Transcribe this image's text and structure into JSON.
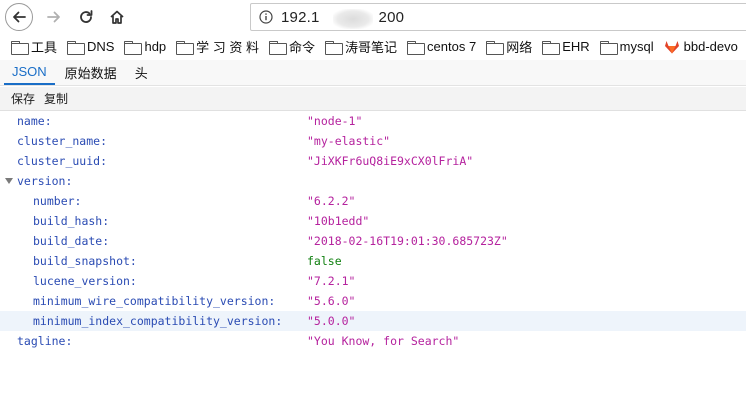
{
  "nav": {
    "url": "192.1",
    "url_suffix": "200"
  },
  "bookmarks": [
    {
      "label": "工具",
      "icon": "folder-icon"
    },
    {
      "label": "DNS",
      "icon": "folder-icon"
    },
    {
      "label": "hdp",
      "icon": "folder-icon"
    },
    {
      "label": "学 习 资 料",
      "icon": "folder-icon"
    },
    {
      "label": "命令",
      "icon": "folder-icon"
    },
    {
      "label": "涛哥笔记",
      "icon": "folder-icon"
    },
    {
      "label": "centos 7",
      "icon": "folder-icon"
    },
    {
      "label": "网络",
      "icon": "folder-icon"
    },
    {
      "label": "EHR",
      "icon": "folder-icon"
    },
    {
      "label": "mysql",
      "icon": "folder-icon"
    },
    {
      "label": "bbd-devo",
      "icon": "gitlab-icon"
    }
  ],
  "tabs": [
    {
      "label": "JSON",
      "active": true
    },
    {
      "label": "原始数据",
      "active": false
    },
    {
      "label": "头",
      "active": false
    }
  ],
  "toolbar": {
    "save_label": "保存",
    "copy_label": "复制"
  },
  "json_rows": [
    {
      "key": "name:",
      "value": "\"node-1\"",
      "kind": "str",
      "indent": 0
    },
    {
      "key": "cluster_name:",
      "value": "\"my-elastic\"",
      "kind": "str",
      "indent": 0
    },
    {
      "key": "cluster_uuid:",
      "value": "\"JiXKFr6uQ8iE9xCX0lFriA\"",
      "kind": "str",
      "indent": 0
    },
    {
      "key": "version:",
      "value": "",
      "kind": "object",
      "indent": 0,
      "expanded": true
    },
    {
      "key": "number:",
      "value": "\"6.2.2\"",
      "kind": "str",
      "indent": 1
    },
    {
      "key": "build_hash:",
      "value": "\"10b1edd\"",
      "kind": "str",
      "indent": 1
    },
    {
      "key": "build_date:",
      "value": "\"2018-02-16T19:01:30.685723Z\"",
      "kind": "str",
      "indent": 1
    },
    {
      "key": "build_snapshot:",
      "value": "false",
      "kind": "bool",
      "indent": 1
    },
    {
      "key": "lucene_version:",
      "value": "\"7.2.1\"",
      "kind": "str",
      "indent": 1
    },
    {
      "key": "minimum_wire_compatibility_version:",
      "value": "\"5.6.0\"",
      "kind": "str",
      "indent": 1
    },
    {
      "key": "minimum_index_compatibility_version:",
      "value": "\"5.0.0\"",
      "kind": "str",
      "indent": 1,
      "highlighted": true
    },
    {
      "key": "tagline:",
      "value": "\"You Know, for Search\"",
      "kind": "str",
      "indent": 0
    }
  ],
  "colors": {
    "key": "#2a4bb3",
    "string": "#b5229e",
    "boolean": "#118111",
    "active_tab": "#1a6ec7"
  }
}
